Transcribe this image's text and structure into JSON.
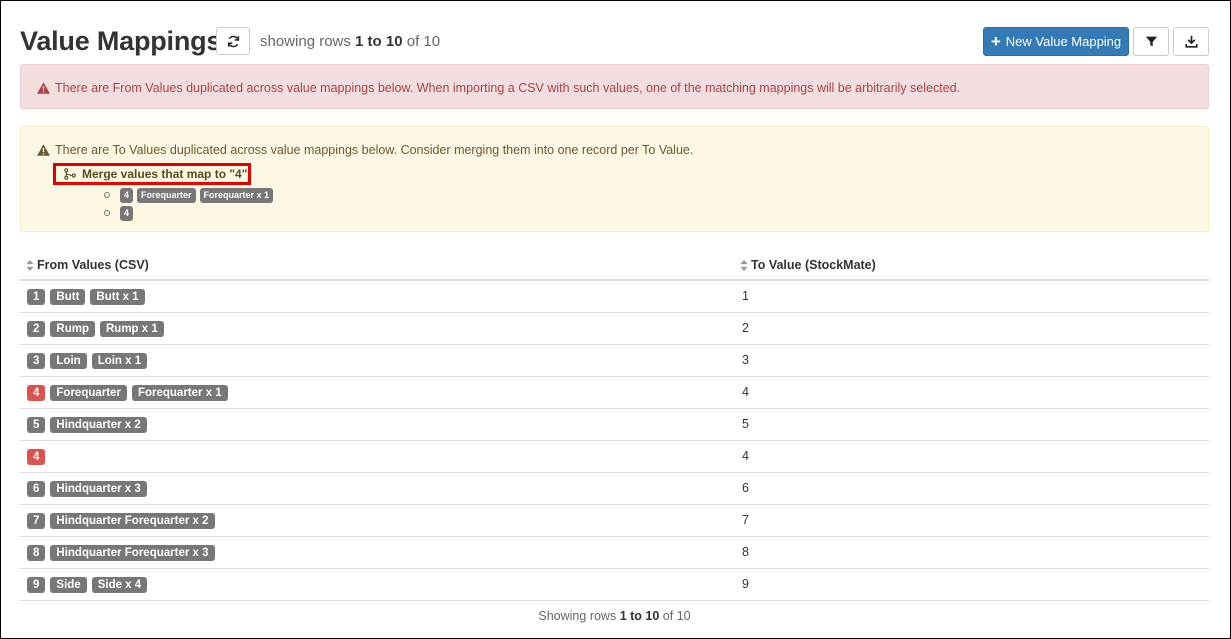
{
  "header": {
    "title": "Value Mappings",
    "rows_prefix": "showing rows",
    "rows_range": "1 to 10",
    "rows_of": "of 10",
    "new_button_label": "New Value Mapping"
  },
  "alerts": {
    "danger_text": "There are From Values duplicated across value mappings below. When importing a CSV with such values, one of the matching mappings will be arbitrarily selected.",
    "warning_text": "There are To Values duplicated across value mappings below. Consider merging them into one record per To Value.",
    "merge_link": "Merge values that map to \"4\"",
    "merge_items": [
      [
        "4",
        "Forequarter",
        "Forequarter x 1"
      ],
      [
        "4"
      ]
    ]
  },
  "table": {
    "col_from": "From Values (CSV)",
    "col_to": "To Value (StockMate)",
    "rows": [
      {
        "from": [
          "1",
          "Butt",
          "Butt x 1"
        ],
        "to": "1",
        "dup": false
      },
      {
        "from": [
          "2",
          "Rump",
          "Rump x 1"
        ],
        "to": "2",
        "dup": false
      },
      {
        "from": [
          "3",
          "Loin",
          "Loin x 1"
        ],
        "to": "3",
        "dup": false
      },
      {
        "from": [
          "4",
          "Forequarter",
          "Forequarter x 1"
        ],
        "to": "4",
        "dup": true
      },
      {
        "from": [
          "5",
          "Hindquarter x 2"
        ],
        "to": "5",
        "dup": false
      },
      {
        "from": [
          "4"
        ],
        "to": "4",
        "dup": true
      },
      {
        "from": [
          "6",
          "Hindquarter x 3"
        ],
        "to": "6",
        "dup": false
      },
      {
        "from": [
          "7",
          "Hindquarter Forequarter x 2"
        ],
        "to": "7",
        "dup": false
      },
      {
        "from": [
          "8",
          "Hindquarter Forequarter x 3"
        ],
        "to": "8",
        "dup": false
      },
      {
        "from": [
          "9",
          "Side",
          "Side x 4"
        ],
        "to": "9",
        "dup": false
      }
    ]
  },
  "footer": {
    "prefix": "Showing rows",
    "range": "1 to 10",
    "of": "of 10"
  },
  "colors": {
    "primary": "#337ab7",
    "danger": "#d9534f",
    "label": "#777777",
    "highlight": "#e00000"
  }
}
